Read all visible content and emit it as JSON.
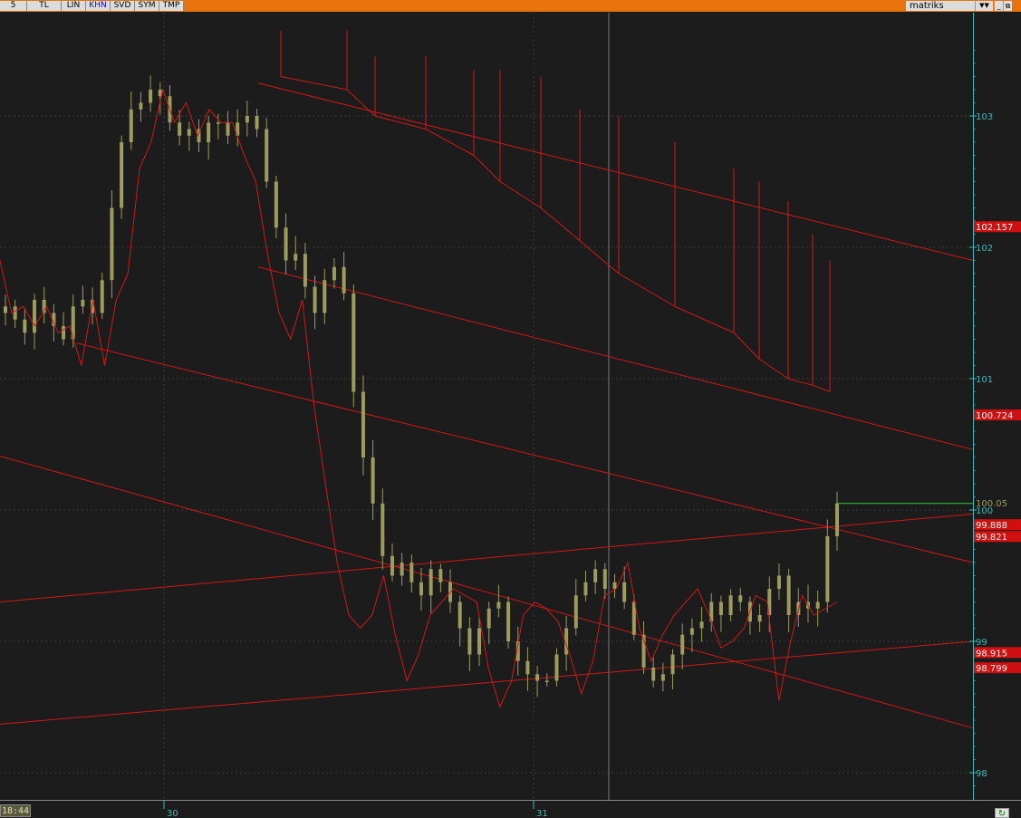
{
  "toolbar": {
    "buttons": [
      {
        "label": "5"
      },
      {
        "label": "TL"
      },
      {
        "label": "LIN"
      },
      {
        "label": "KHN",
        "active": true
      },
      {
        "label": "SVD"
      },
      {
        "label": "SYM"
      },
      {
        "label": "TMP"
      }
    ],
    "brand": "matriks",
    "brand_menu_icon": "dropdown-arrows-icon",
    "window_buttons": [
      "minimize-icon",
      "restore-icon"
    ]
  },
  "status": {
    "time": "18:44",
    "refresh_icon": "refresh-icon"
  },
  "colors": {
    "background": "#1c1c1c",
    "grid": "#3a3a3a",
    "candles": "#9c9c5e",
    "indicator_line": "#d01818",
    "channel_lines": "#d21616",
    "price_axis_text": "#46b4b4",
    "axis_line": "#46b4b4",
    "last_price_line": "#2ecc2e",
    "toolbar": "#e8730c",
    "badge_bg": "#d01010"
  },
  "chart_data": {
    "type": "candlestick",
    "x_ticks": [
      "30",
      "31"
    ],
    "y_ticks": [
      98,
      99,
      100,
      101,
      102,
      103
    ],
    "ylim": [
      97.92,
      103.55
    ],
    "grid": true,
    "last_price": {
      "label": "100.05",
      "value": 100.05
    },
    "level_badges": [
      {
        "label": "102.157",
        "value": 102.157
      },
      {
        "label": "100.724",
        "value": 100.724
      },
      {
        "label": "99.888",
        "value": 99.888
      },
      {
        "label": "99.821",
        "value": 99.821
      },
      {
        "label": "98.915",
        "value": 98.915
      },
      {
        "label": "98.799",
        "value": 98.799
      }
    ],
    "candle_closes": [
      101.55,
      101.45,
      101.35,
      101.6,
      101.5,
      101.4,
      101.3,
      101.55,
      101.6,
      101.5,
      101.75,
      102.3,
      102.8,
      103.05,
      103.1,
      103.2,
      103.15,
      102.95,
      102.85,
      102.9,
      102.8,
      102.95,
      102.95,
      102.85,
      102.95,
      103.0,
      102.9,
      102.5,
      102.15,
      101.9,
      101.95,
      101.7,
      101.5,
      101.75,
      101.85,
      101.65,
      100.9,
      100.4,
      100.05,
      99.65,
      99.5,
      99.6,
      99.45,
      99.35,
      99.55,
      99.45,
      99.3,
      99.1,
      98.9,
      99.1,
      99.25,
      99.3,
      99.0,
      98.85,
      98.75,
      98.7,
      98.7,
      98.9,
      99.1,
      99.35,
      99.45,
      99.55,
      99.4,
      99.45,
      99.3,
      99.05,
      98.8,
      98.7,
      98.75,
      98.9,
      99.05,
      99.1,
      99.15,
      99.3,
      99.2,
      99.35,
      99.3,
      99.15,
      99.2,
      99.4,
      99.5,
      99.2,
      99.3,
      99.25,
      99.3,
      99.8,
      100.05
    ],
    "indicator_series": [
      101.9,
      101.5,
      101.55,
      101.4,
      101.55,
      101.35,
      101.4,
      101.1,
      101.6,
      101.1,
      101.6,
      101.8,
      102.6,
      102.8,
      103.2,
      102.95,
      103.1,
      102.85,
      103.05,
      102.95,
      102.95,
      102.7,
      102.5,
      101.95,
      101.5,
      101.3,
      101.6,
      100.8,
      100.2,
      99.6,
      99.2,
      99.1,
      99.2,
      99.5,
      99.05,
      98.7,
      98.9,
      99.2,
      99.3,
      99.4,
      99.35,
      99.3,
      98.8,
      98.5,
      98.7,
      99.2,
      99.3,
      99.25,
      99.15,
      98.9,
      98.6,
      98.85,
      99.35,
      99.4,
      99.6,
      99.1,
      98.85,
      99.05,
      99.2,
      99.3,
      99.4,
      99.2,
      98.95,
      99.0,
      99.1,
      99.35,
      99.3,
      98.55,
      99.0,
      99.35,
      99.2,
      99.25,
      99.3
    ],
    "tail_highs": [
      103.65,
      103.65,
      103.45,
      103.45,
      103.35,
      103.35,
      103.3,
      103.05,
      103.0,
      102.8,
      102.6,
      102.5,
      102.35,
      102.1,
      101.9
    ],
    "tail_lows": [
      103.3,
      103.2,
      103.0,
      102.9,
      102.7,
      102.5,
      102.3,
      102.05,
      101.8,
      101.55,
      101.35,
      101.15,
      101.0,
      100.95,
      100.9
    ]
  }
}
